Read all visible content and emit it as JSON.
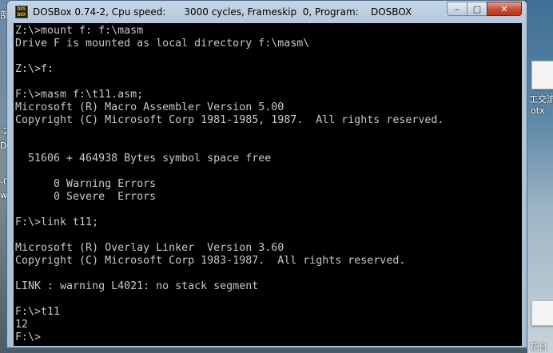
{
  "window": {
    "title": "DOSBox 0.74-2, Cpu speed:      3000 cycles, Frameskip  0, Program:    DOSBOX",
    "icon_text": "DOS BOX",
    "buttons": {
      "minimize_label": "–",
      "maximize_label": "□",
      "close_label": "✕"
    }
  },
  "console_lines": [
    "Z:\\>mount f: f:\\masm",
    "Drive F is mounted as local directory f:\\masm\\",
    "",
    "Z:\\>f:",
    "",
    "F:\\>masm f:\\t11.asm;",
    "Microsoft (R) Macro Assembler Version 5.00",
    "Copyright (C) Microsoft Corp 1981-1985, 1987.  All rights reserved.",
    "",
    "",
    "  51606 + 464938 Bytes symbol space free",
    "",
    "      0 Warning Errors",
    "      0 Severe  Errors",
    "",
    "F:\\>link t11;",
    "",
    "Microsoft (R) Overlay Linker  Version 3.60",
    "Copyright (C) Microsoft Corp 1983-1987.  All rights reserved.",
    "",
    "LINK : warning L4021: no stack segment",
    "",
    "F:\\>t11",
    "12",
    "F:\\>"
  ],
  "desktop": {
    "right_labels": [
      "工交流",
      "otx",
      "花台"
    ],
    "left_fragments": [
      "部",
      "-2",
      "D",
      "-0",
      "wi"
    ]
  },
  "colors": {
    "console_bg": "#000000",
    "console_fg": "#c8c8c8",
    "close_button": "#c74a35"
  }
}
